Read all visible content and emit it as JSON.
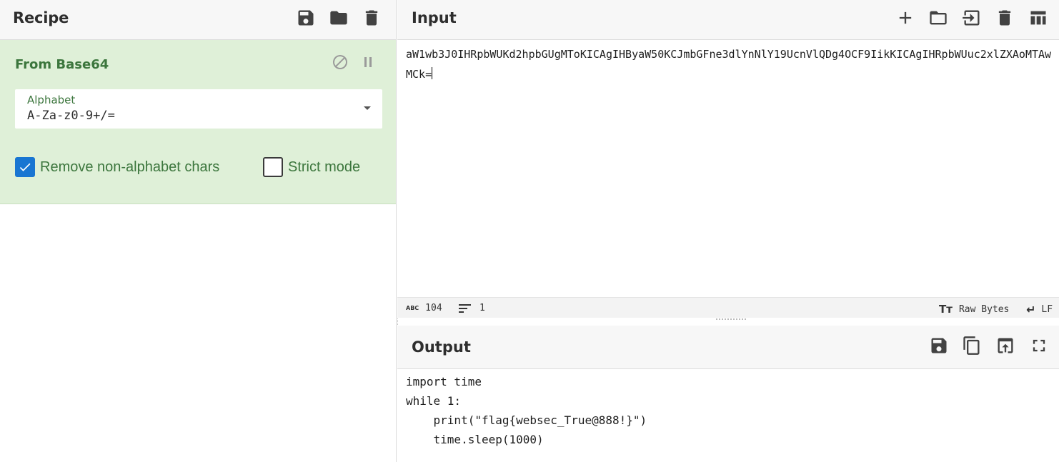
{
  "recipe": {
    "title": "Recipe",
    "header_icons": [
      "save-icon",
      "folder-icon",
      "trash-icon"
    ],
    "operation": {
      "name": "From Base64",
      "icons": [
        "disable-icon",
        "pause-icon"
      ],
      "alphabet_label": "Alphabet",
      "alphabet_value": "A-Za-z0-9+/=",
      "remove_nonalphabet": {
        "label": "Remove non-alphabet chars",
        "checked": true
      },
      "strict_mode": {
        "label": "Strict mode",
        "checked": false
      }
    }
  },
  "input": {
    "title": "Input",
    "header_icons": [
      "plus-icon",
      "folder-icon",
      "import-icon",
      "trash-icon",
      "layout-icon"
    ],
    "text": "aW1wb3J0IHRpbWUKd2hpbGUgMToKICAgIHByaW50KCJmbGFne3dlYnNlY19UcnVlQDg4OCF9IikKICAgIHRpbWUuc2xlZXAoMTAwMCk=",
    "status": {
      "length": "104",
      "lines": "1",
      "encoding": "Raw Bytes",
      "eol": "LF"
    }
  },
  "output": {
    "title": "Output",
    "header_icons": [
      "save-icon",
      "copy-icon",
      "replace-input-icon",
      "fullscreen-icon"
    ],
    "text": "import time\nwhile 1:\n    print(\"flag{websec_True@888!}\")\n    time.sleep(1000)"
  },
  "colors": {
    "operation_bg": "#dff0d8",
    "operation_text": "#3c763d",
    "checkbox_checked": "#1976d2"
  }
}
